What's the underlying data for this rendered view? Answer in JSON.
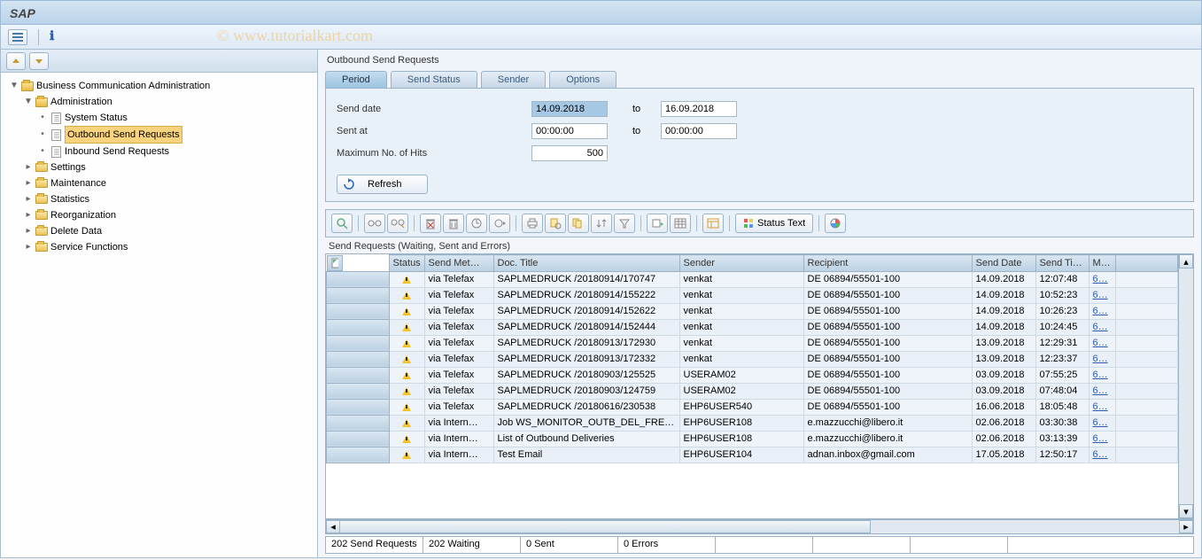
{
  "app_title": "SAP",
  "section_title": "Outbound Send Requests",
  "left_tree": {
    "root": "Business Communication Administration",
    "admin": "Administration",
    "admin_items": [
      "System Status",
      "Outbound Send Requests",
      "Inbound Send Requests"
    ],
    "selected": "Outbound Send Requests",
    "folders": [
      "Settings",
      "Maintenance",
      "Statistics",
      "Reorganization",
      "Delete Data",
      "Service Functions"
    ]
  },
  "tabs": [
    "Period",
    "Send Status",
    "Sender",
    "Options"
  ],
  "form": {
    "send_date_lbl": "Send date",
    "send_date_from": "14.09.2018",
    "send_date_to": "16.09.2018",
    "sent_at_lbl": "Sent at",
    "sent_at_from": "00:00:00",
    "sent_at_to": "00:00:00",
    "max_hits_lbl": "Maximum No. of Hits",
    "max_hits": "500",
    "to_lbl": "to",
    "refresh": "Refresh"
  },
  "grid_caption": "Send Requests (Waiting, Sent and Errors)",
  "status_text_btn": "Status Text",
  "columns": {
    "status": "Status",
    "method": "Send Met…",
    "title": "Doc. Title",
    "sender": "Sender",
    "recipient": "Recipient",
    "date": "Send Date",
    "time": "Send Ti…",
    "m": "M…"
  },
  "rows": [
    {
      "method": "via Telefax",
      "title": "SAPLMEDRUCK /20180914/170747",
      "sender": "venkat",
      "recipient": "DE 06894/55501-100",
      "date": "14.09.2018",
      "time": "12:07:48",
      "m": "6…"
    },
    {
      "method": "via Telefax",
      "title": "SAPLMEDRUCK /20180914/155222",
      "sender": "venkat",
      "recipient": "DE 06894/55501-100",
      "date": "14.09.2018",
      "time": "10:52:23",
      "m": "6…"
    },
    {
      "method": "via Telefax",
      "title": "SAPLMEDRUCK /20180914/152622",
      "sender": "venkat",
      "recipient": "DE 06894/55501-100",
      "date": "14.09.2018",
      "time": "10:26:23",
      "m": "6…"
    },
    {
      "method": "via Telefax",
      "title": "SAPLMEDRUCK /20180914/152444",
      "sender": "venkat",
      "recipient": "DE 06894/55501-100",
      "date": "14.09.2018",
      "time": "10:24:45",
      "m": "6…"
    },
    {
      "method": "via Telefax",
      "title": "SAPLMEDRUCK /20180913/172930",
      "sender": "venkat",
      "recipient": "DE 06894/55501-100",
      "date": "13.09.2018",
      "time": "12:29:31",
      "m": "6…"
    },
    {
      "method": "via Telefax",
      "title": "SAPLMEDRUCK /20180913/172332",
      "sender": "venkat",
      "recipient": "DE 06894/55501-100",
      "date": "13.09.2018",
      "time": "12:23:37",
      "m": "6…"
    },
    {
      "method": "via Telefax",
      "title": "SAPLMEDRUCK /20180903/125525",
      "sender": "USERAM02",
      "recipient": "DE 06894/55501-100",
      "date": "03.09.2018",
      "time": "07:55:25",
      "m": "6…"
    },
    {
      "method": "via Telefax",
      "title": "SAPLMEDRUCK /20180903/124759",
      "sender": "USERAM02",
      "recipient": "DE 06894/55501-100",
      "date": "03.09.2018",
      "time": "07:48:04",
      "m": "6…"
    },
    {
      "method": "via Telefax",
      "title": "SAPLMEDRUCK /20180616/230538",
      "sender": "EHP6USER540",
      "recipient": "DE 06894/55501-100",
      "date": "16.06.2018",
      "time": "18:05:48",
      "m": "6…"
    },
    {
      "method": "via Intern…",
      "title": "Job WS_MONITOR_OUTB_DEL_FRE…",
      "sender": "EHP6USER108",
      "recipient": "e.mazzucchi@libero.it",
      "date": "02.06.2018",
      "time": "03:30:38",
      "m": "6…"
    },
    {
      "method": "via Intern…",
      "title": "List of Outbound Deliveries",
      "sender": "EHP6USER108",
      "recipient": "e.mazzucchi@libero.it",
      "date": "02.06.2018",
      "time": "03:13:39",
      "m": "6…"
    },
    {
      "method": "via Intern…",
      "title": "Test Email",
      "sender": "EHP6USER104",
      "recipient": "adnan.inbox@gmail.com",
      "date": "17.05.2018",
      "time": "12:50:17",
      "m": "6…"
    }
  ],
  "status_bar": {
    "c1": "202 Send Requests",
    "c2": "202 Waiting",
    "c3": "0 Sent",
    "c4": "0 Errors"
  }
}
